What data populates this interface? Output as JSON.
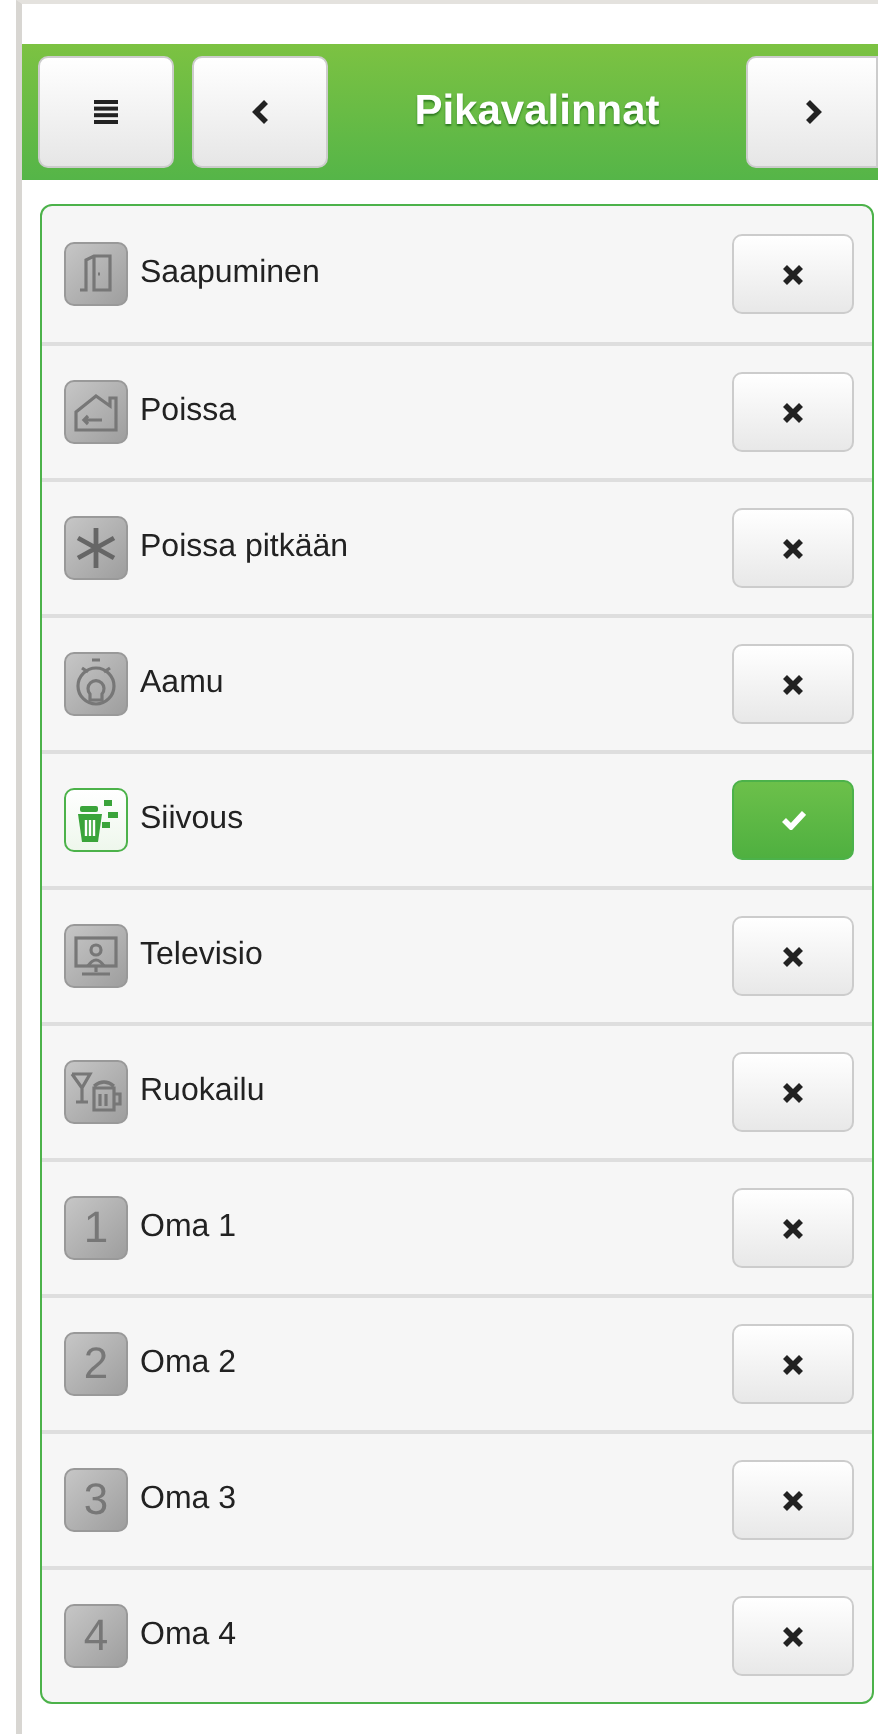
{
  "header": {
    "title": "Pikavalinnat"
  },
  "items": [
    {
      "label": "Saapuminen",
      "kind": "door",
      "on": false
    },
    {
      "label": "Poissa",
      "kind": "house",
      "on": false
    },
    {
      "label": "Poissa pitkään",
      "kind": "snowflake",
      "on": false
    },
    {
      "label": "Aamu",
      "kind": "morning",
      "on": false
    },
    {
      "label": "Siivous",
      "kind": "cleaning",
      "on": true
    },
    {
      "label": "Televisio",
      "kind": "tv",
      "on": false
    },
    {
      "label": "Ruokailu",
      "kind": "dining",
      "on": false
    },
    {
      "label": "Oma 1",
      "kind": "number",
      "number": "1",
      "on": false
    },
    {
      "label": "Oma 2",
      "kind": "number",
      "number": "2",
      "on": false
    },
    {
      "label": "Oma 3",
      "kind": "number",
      "number": "3",
      "on": false
    },
    {
      "label": "Oma 4",
      "kind": "number",
      "number": "4",
      "on": false
    }
  ]
}
